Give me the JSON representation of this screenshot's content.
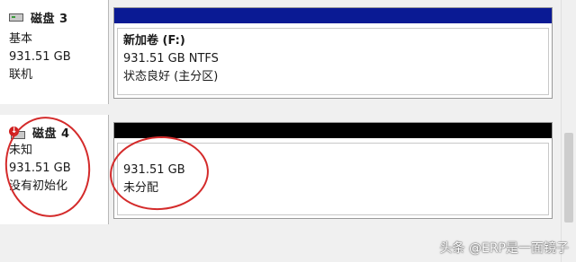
{
  "disks": [
    {
      "title": "磁盘 3",
      "type": "基本",
      "size": "931.51 GB",
      "status": "联机",
      "icon": "disk-icon",
      "volume": {
        "name": "新加卷  (F:)",
        "size_fs": "931.51 GB NTFS",
        "status": "状态良好 (主分区)",
        "bar_color": "#0a1a94"
      }
    },
    {
      "title": "磁盘 4",
      "type": "未知",
      "size": "931.51 GB",
      "status": "没有初始化",
      "icon": "disk-error-icon",
      "volume": {
        "size": "931.51 GB",
        "status": "未分配",
        "bar_color": "#000000"
      }
    }
  ],
  "annotation_color": "#d42b2b",
  "watermark": "头条 @ERP是一面镜子"
}
